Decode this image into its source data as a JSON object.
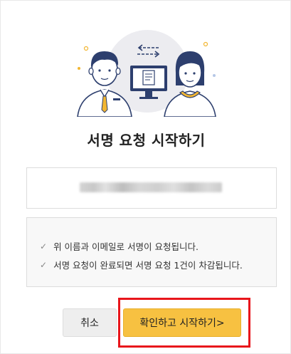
{
  "dialog": {
    "title": "서명 요청 시작하기",
    "recipient_masked": "",
    "notices": [
      "위 이름과 이메일로 서명이 요청됩니다.",
      "서명 요청이 완료되면 서명 요청 1건이 차감됩니다."
    ],
    "buttons": {
      "cancel": "취소",
      "confirm": "확인하고 시작하기>"
    },
    "illustration": "two-people-document-monitor-illustration"
  },
  "colors": {
    "accent": "#f7c141",
    "highlight": "#e8151b",
    "cancel_bg": "#eeeeee"
  },
  "icons": [
    "check-icon",
    "monitor-icon",
    "document-icon",
    "exchange-arrows-icon"
  ]
}
